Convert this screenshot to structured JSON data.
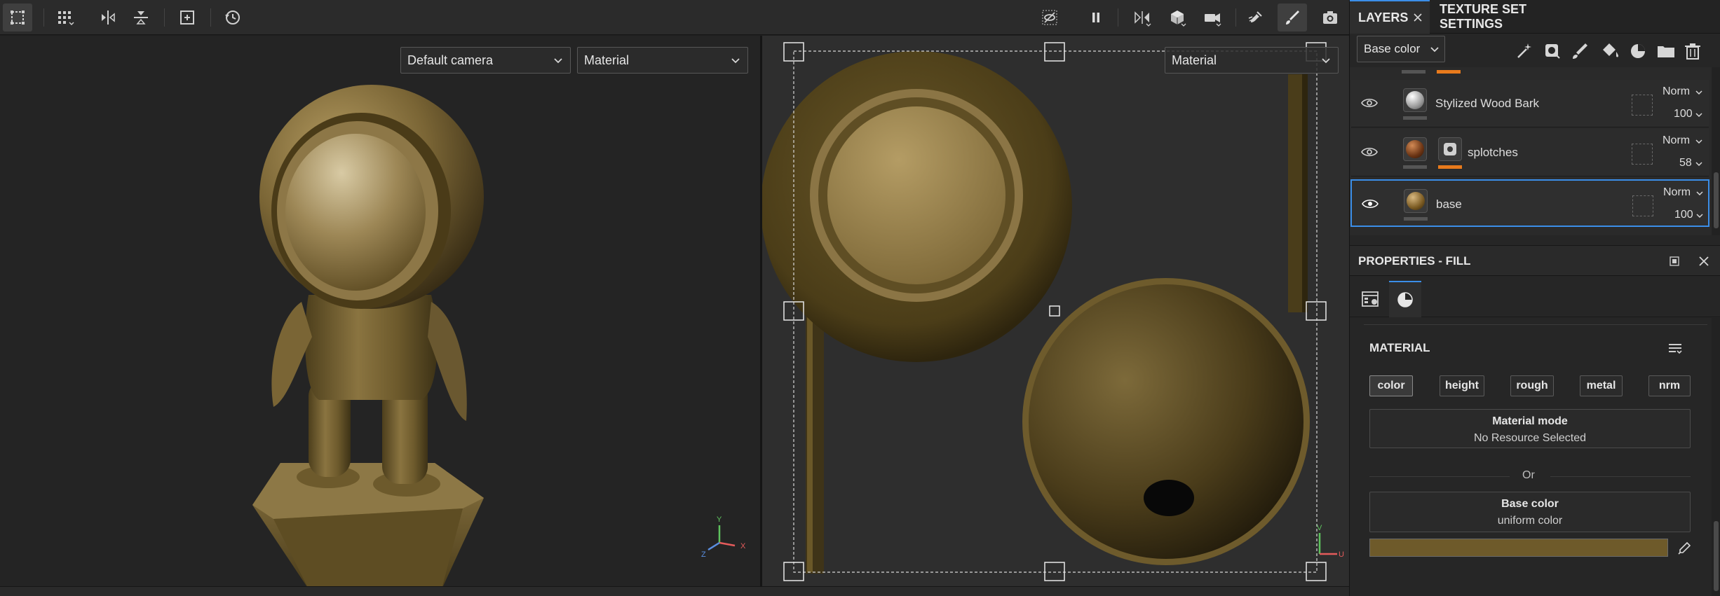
{
  "colors": {
    "accent": "#3b8ee8",
    "base_color": "#6e5a2a",
    "mask_bar": "#e87a1c"
  },
  "toolbar": {
    "left_tools": [
      "selection-mode-icon",
      "grid-layout-icon",
      "mirror-horizontal-icon",
      "mirror-vertical-icon",
      "frame-icon",
      "reset-camera-icon"
    ],
    "right_tools": [
      "hide-icon",
      "pause-icon",
      "symmetry-icon",
      "cube-display-icon",
      "camera-icon",
      "smudge-icon",
      "paint-brush-icon",
      "screenshot-icon"
    ]
  },
  "viewport3d": {
    "camera_dropdown": "Default camera",
    "mode_dropdown": "Material",
    "gizmo": {
      "y": "Y",
      "x": "X",
      "z": "Z"
    }
  },
  "viewport2d": {
    "mode_dropdown": "Material",
    "gizmo": {
      "v": "V",
      "u": "U"
    }
  },
  "layers_panel": {
    "tab_layers": "LAYERS",
    "tab_texture": "TEXTURE SET SETTINGS",
    "channel_dropdown": "Base color",
    "layers": [
      {
        "name": "Stylized Wood Bark",
        "blend": "Norm",
        "opacity": "100",
        "mask": false,
        "selected": false
      },
      {
        "name": "splotches",
        "blend": "Norm",
        "opacity": "58",
        "mask": true,
        "selected": false
      },
      {
        "name": "base",
        "blend": "Norm",
        "opacity": "100",
        "mask": false,
        "selected": true
      }
    ]
  },
  "properties": {
    "title": "PROPERTIES - FILL",
    "section_title": "MATERIAL",
    "channels": [
      "color",
      "height",
      "rough",
      "metal",
      "nrm"
    ],
    "material_mode_title": "Material mode",
    "material_mode_value": "No Resource Selected",
    "or_text": "Or",
    "base_color_title": "Base color",
    "base_color_value": "uniform color"
  }
}
